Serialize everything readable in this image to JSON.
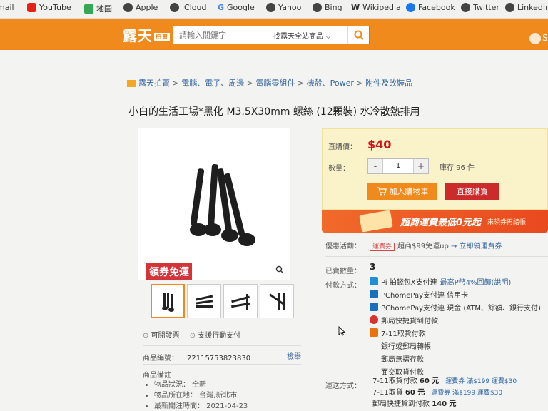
{
  "bookmarks": [
    {
      "label": "mail",
      "color": "#888"
    },
    {
      "label": "YouTube",
      "color": "#e62117"
    },
    {
      "label": "地圖",
      "color": "#34a853"
    },
    {
      "label": "Apple",
      "color": "#333"
    },
    {
      "label": "iCloud",
      "color": "#333"
    },
    {
      "label": "Google",
      "color": "#4285f4"
    },
    {
      "label": "Yahoo",
      "color": "#333"
    },
    {
      "label": "Bing",
      "color": "#333"
    },
    {
      "label": "Wikipedia",
      "color": "#333"
    },
    {
      "label": "Facebook",
      "color": "#1877f2"
    },
    {
      "label": "Twitter",
      "color": "#333"
    },
    {
      "label": "LinkedIn",
      "color": "#333"
    }
  ],
  "header": {
    "logo": "露天",
    "logo_badge": "拍賣",
    "search_placeholder": "請輸入關鍵字",
    "search_scope": "找露天全站商品",
    "right_text": "S",
    "brand_color": "#f08a1c"
  },
  "breadcrumb": [
    "露天拍賣",
    "電腦、電子、周邊",
    "電腦零組件",
    "機殼、Power",
    "附件及改裝品"
  ],
  "product": {
    "title": "小白的生活工場*黑化 M3.5X30mm 螺絲 (12顆裝) 水冷散熱排用",
    "promo_tag": "領券免運",
    "pay_notes": [
      "可開發票",
      "支援行動支付"
    ],
    "id_label": "商品編號：",
    "id_value": "22115753823830",
    "report": "檢舉",
    "notes_title": "商品備註",
    "notes": [
      "物品狀況： 全新",
      "物品所在地： 台灣,新北市",
      "最新關注時間： 2021-04-23"
    ]
  },
  "purchase": {
    "price_label": "直購價：",
    "price": "$40",
    "qty_label": "數量：",
    "qty_minus": "-",
    "qty_value": "1",
    "qty_plus": "+",
    "stock": "庫存 96 件",
    "add_cart": "加入購物車",
    "buy_now": "直接購買",
    "banner_main": "超商運費最低0元起",
    "banner_sub": "來領券再結帳",
    "accent_red": "#d0141c"
  },
  "promo": {
    "label": "優惠活動：",
    "tag": "運費券",
    "text": "超商$99免運up",
    "link": "→ 立即領運費券"
  },
  "details": {
    "sold_label": "已賣數量：",
    "sold_value": "3",
    "pay_label": "付款方式：",
    "ship_label": "運送方式：",
    "pay_methods": [
      {
        "text": "Pi 拍錢包X支付連",
        "extra": "最高P幣4%回饋(說明)",
        "color": "#1f8fd6"
      },
      {
        "text": "PChomePay支付連 信用卡",
        "extra": "",
        "color": "#1a6fbf"
      },
      {
        "text": "PChomePay支付連 現金 (ATM、餘額、銀行支付)",
        "extra": "",
        "color": "#1a6fbf"
      },
      {
        "text": "郵局快捷貨到付款",
        "extra": "",
        "color": "#d6342c"
      },
      {
        "text": "7-11取貨付款",
        "extra": "",
        "color": "#e8720c"
      },
      {
        "text": "銀行或郵局轉帳",
        "extra": "",
        "color": ""
      },
      {
        "text": "郵局無摺存款",
        "extra": "",
        "color": ""
      },
      {
        "text": "面交取貨付款",
        "extra": "",
        "color": ""
      }
    ],
    "ship_methods": [
      {
        "text": "7-11取貨付款",
        "price": "60 元",
        "coupon": "運費券 滿$199 運費$30"
      },
      {
        "text": "7-11取貨",
        "price": "60 元",
        "coupon": "運費券 滿$199 運費$30"
      },
      {
        "text": "郵局快捷貨到付款",
        "price": "140 元",
        "coupon": ""
      }
    ]
  }
}
